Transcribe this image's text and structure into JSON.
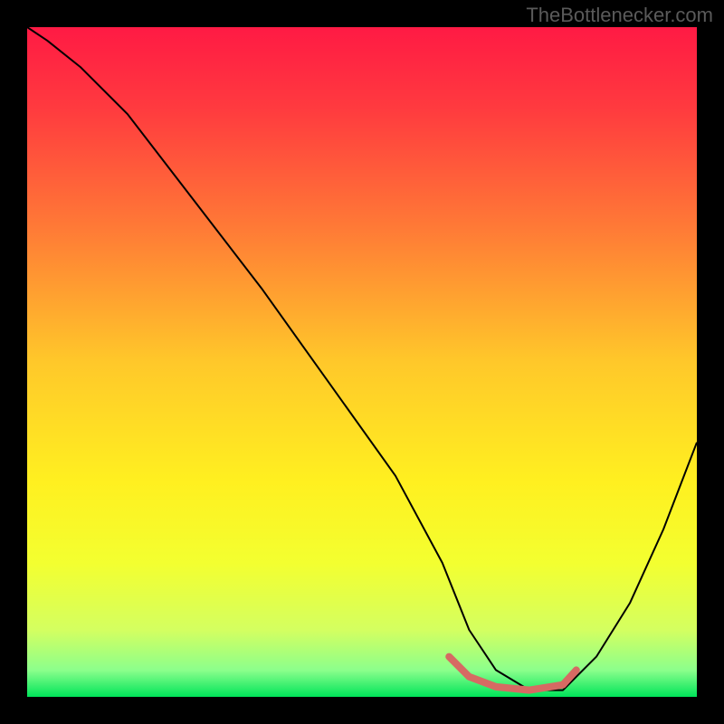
{
  "watermark": "TheBottlenecker.com",
  "chart_data": {
    "type": "line",
    "title": "",
    "xlabel": "",
    "ylabel": "",
    "xlim": [
      0,
      100
    ],
    "ylim": [
      0,
      100
    ],
    "grid": false,
    "background_gradient": {
      "stops": [
        {
          "pos": 0.0,
          "color": "#ff1a44"
        },
        {
          "pos": 0.12,
          "color": "#ff3a3f"
        },
        {
          "pos": 0.3,
          "color": "#ff7a36"
        },
        {
          "pos": 0.5,
          "color": "#ffc82a"
        },
        {
          "pos": 0.68,
          "color": "#fff020"
        },
        {
          "pos": 0.8,
          "color": "#f3ff30"
        },
        {
          "pos": 0.9,
          "color": "#d4ff60"
        },
        {
          "pos": 0.96,
          "color": "#8cff8c"
        },
        {
          "pos": 1.0,
          "color": "#00e45a"
        }
      ]
    },
    "series": [
      {
        "name": "bottleneck-curve",
        "color": "#000000",
        "width": 2,
        "x": [
          0,
          3,
          8,
          15,
          25,
          35,
          45,
          55,
          62,
          66,
          70,
          75,
          80,
          85,
          90,
          95,
          100
        ],
        "y": [
          100,
          98,
          94,
          87,
          74,
          61,
          47,
          33,
          20,
          10,
          4,
          1,
          1,
          6,
          14,
          25,
          38
        ]
      },
      {
        "name": "optimal-range-marker",
        "color": "#d66a63",
        "width": 8,
        "linecap": "round",
        "x": [
          63,
          66,
          70,
          75,
          80,
          82
        ],
        "y": [
          6,
          3,
          1.5,
          1,
          1.8,
          4
        ]
      }
    ]
  }
}
